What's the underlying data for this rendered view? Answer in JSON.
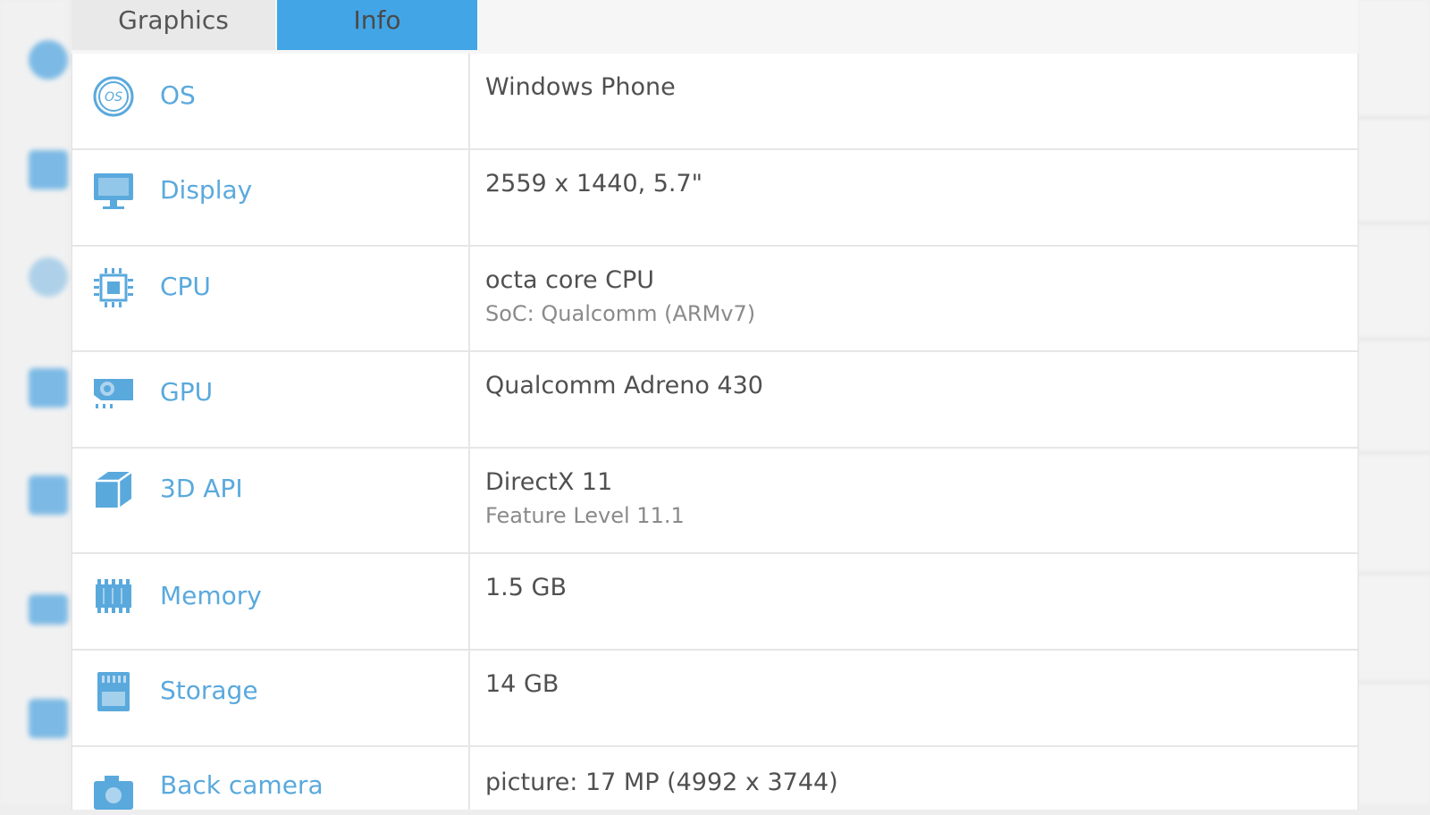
{
  "tabs": [
    {
      "label": "Graphics",
      "active": false
    },
    {
      "label": "Info",
      "active": true
    }
  ],
  "colors": {
    "accent": "#42a5e6",
    "label_blue": "#5aa9dd"
  },
  "rows": [
    {
      "icon": "os-icon",
      "label": "OS",
      "value": "Windows Phone",
      "sub": ""
    },
    {
      "icon": "display-icon",
      "label": "Display",
      "value": "2559 x 1440, 5.7\"",
      "sub": ""
    },
    {
      "icon": "cpu-icon",
      "label": "CPU",
      "value": "octa core CPU",
      "sub": "SoC: Qualcomm (ARMv7)"
    },
    {
      "icon": "gpu-icon",
      "label": "GPU",
      "value": "Qualcomm Adreno 430",
      "sub": ""
    },
    {
      "icon": "3d-api-icon",
      "label": "3D API",
      "value": "DirectX 11",
      "sub": "Feature Level 11.1"
    },
    {
      "icon": "memory-icon",
      "label": "Memory",
      "value": "1.5 GB",
      "sub": ""
    },
    {
      "icon": "storage-icon",
      "label": "Storage",
      "value": "14 GB",
      "sub": ""
    },
    {
      "icon": "camera-icon",
      "label": "Back camera",
      "value": "picture: 17 MP (4992 x 3744)",
      "sub": ""
    }
  ]
}
